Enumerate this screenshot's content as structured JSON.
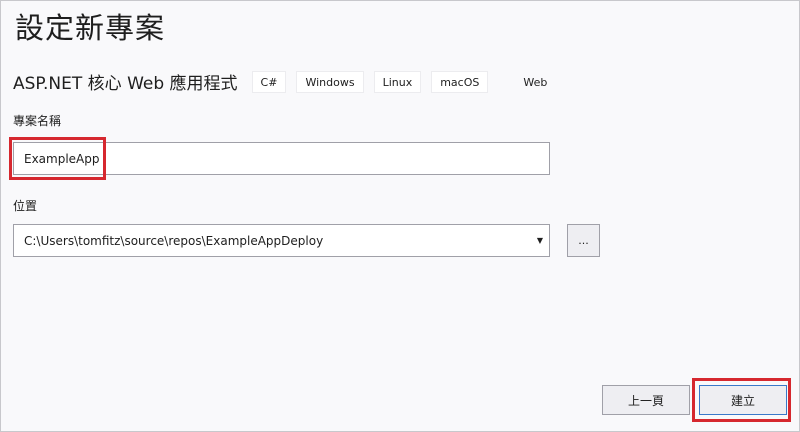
{
  "page": {
    "title": "設定新專案"
  },
  "template": {
    "name": "ASP.NET 核心 Web 應用程式",
    "tags": [
      "C#",
      "Windows",
      "Linux",
      "macOS",
      "Web"
    ]
  },
  "project_name": {
    "label": "專案名稱",
    "value": "ExampleApp"
  },
  "location": {
    "label": "位置",
    "value": "C:\\Users\\tomfitz\\source\\repos\\ExampleAppDeploy",
    "browse_label": "..."
  },
  "footer": {
    "back_label": "上一頁",
    "create_label": "建立"
  },
  "colors": {
    "highlight": "#d6282f",
    "primary_border": "#3a78c9"
  },
  "icons": {
    "dropdown": "chevron-down-icon"
  }
}
